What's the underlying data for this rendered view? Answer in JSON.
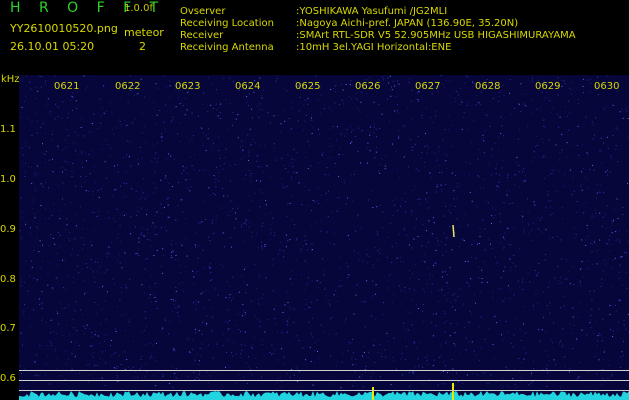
{
  "header": {
    "app_title": "H R O F F T",
    "version": "1.0.0f",
    "file_name": "YY2610010520.png",
    "capture_time": "26.10.01 05:20",
    "meteor_label": "meteor",
    "meteor_count": "2"
  },
  "info": [
    {
      "key": "Ovserver",
      "value": ":YOSHIKAWA Yasufumi /JG2MLI"
    },
    {
      "key": "Receiving Location",
      "value": ":Nagoya Aichi-pref. JAPAN (136.90E, 35.20N)"
    },
    {
      "key": "Receiver",
      "value": ":SMArt RTL-SDR V5 52.905MHz USB HIGASHIMURAYAMA"
    },
    {
      "key": "Receiving Antenna",
      "value": ":10mH 3el.YAGI Horizontal:ENE"
    }
  ],
  "axis": {
    "y_unit": "kHz",
    "y_ticks": [
      "1.1",
      "1.0",
      "0.9",
      "0.8",
      "0.7",
      "0.6"
    ],
    "x_ticks": [
      "0621",
      "0622",
      "0623",
      "0624",
      "0625",
      "0626",
      "0627",
      "0628",
      "0629",
      "0630"
    ]
  },
  "colors": {
    "background": "#06063a",
    "noise": "#3a46d8",
    "baseline": "#22d4e0",
    "accent": "#d8d800"
  }
}
